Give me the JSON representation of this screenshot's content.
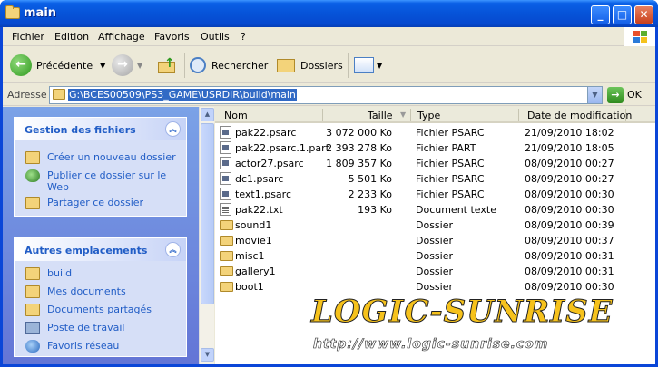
{
  "window": {
    "title": "main"
  },
  "menu": [
    "Fichier",
    "Edition",
    "Affichage",
    "Favoris",
    "Outils",
    "?"
  ],
  "toolbar": {
    "back": "Précédente",
    "search": "Rechercher",
    "folders": "Dossiers"
  },
  "address": {
    "label": "Adresse",
    "value": "G:\\BCES00509\\PS3_GAME\\USRDIR\\build\\main",
    "go": "OK"
  },
  "tasks_panel": {
    "title": "Gestion des fichiers",
    "items": [
      {
        "label": "Créer un nouveau dossier",
        "icon": "new-folder-icon"
      },
      {
        "label": "Publier ce dossier sur le Web",
        "icon": "publish-web-icon"
      },
      {
        "label": "Partager ce dossier",
        "icon": "share-folder-icon"
      }
    ]
  },
  "places_panel": {
    "title": "Autres emplacements",
    "items": [
      {
        "label": "build",
        "icon": "folder-icon"
      },
      {
        "label": "Mes documents",
        "icon": "my-documents-icon"
      },
      {
        "label": "Documents partagés",
        "icon": "shared-documents-icon"
      },
      {
        "label": "Poste de travail",
        "icon": "my-computer-icon"
      },
      {
        "label": "Favoris réseau",
        "icon": "network-icon"
      }
    ]
  },
  "columns": [
    "Nom",
    "Taille",
    "Type",
    "Date de modification"
  ],
  "files": [
    {
      "name": "pak22.psarc",
      "size": "3 072 000 Ko",
      "type": "Fichier PSARC",
      "date": "21/09/2010 18:02",
      "icon": "doc"
    },
    {
      "name": "pak22.psarc.1.part",
      "size": "2 393 278 Ko",
      "type": "Fichier PART",
      "date": "21/09/2010 18:05",
      "icon": "doc"
    },
    {
      "name": "actor27.psarc",
      "size": "1 809 357 Ko",
      "type": "Fichier PSARC",
      "date": "08/09/2010 00:27",
      "icon": "doc"
    },
    {
      "name": "dc1.psarc",
      "size": "5 501 Ko",
      "type": "Fichier PSARC",
      "date": "08/09/2010 00:27",
      "icon": "doc"
    },
    {
      "name": "text1.psarc",
      "size": "2 233 Ko",
      "type": "Fichier PSARC",
      "date": "08/09/2010 00:30",
      "icon": "doc"
    },
    {
      "name": "pak22.txt",
      "size": "193 Ko",
      "type": "Document texte",
      "date": "08/09/2010 00:30",
      "icon": "txt"
    },
    {
      "name": "sound1",
      "size": "",
      "type": "Dossier",
      "date": "08/09/2010 00:39",
      "icon": "fold"
    },
    {
      "name": "movie1",
      "size": "",
      "type": "Dossier",
      "date": "08/09/2010 00:37",
      "icon": "fold"
    },
    {
      "name": "misc1",
      "size": "",
      "type": "Dossier",
      "date": "08/09/2010 00:31",
      "icon": "fold"
    },
    {
      "name": "gallery1",
      "size": "",
      "type": "Dossier",
      "date": "08/09/2010 00:31",
      "icon": "fold"
    },
    {
      "name": "boot1",
      "size": "",
      "type": "Dossier",
      "date": "08/09/2010 00:30",
      "icon": "fold"
    }
  ],
  "watermark": {
    "main": "LOGIC-SUNRISE",
    "sub": "http://www.logic-sunrise.com"
  }
}
